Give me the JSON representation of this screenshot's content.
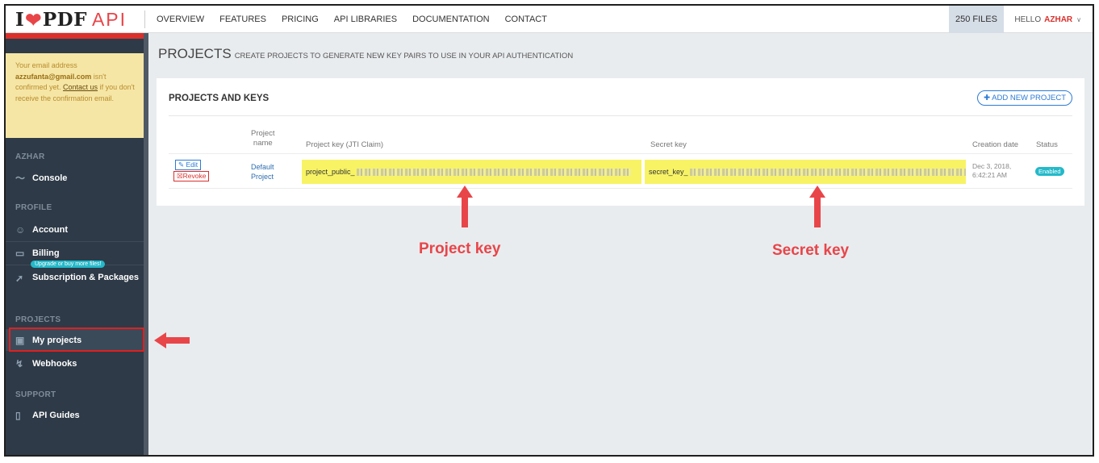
{
  "brand": {
    "i": "I",
    "pdf": "PDF",
    "api": "API"
  },
  "nav": [
    "OVERVIEW",
    "FEATURES",
    "PRICING",
    "API LIBRARIES",
    "DOCUMENTATION",
    "CONTACT"
  ],
  "header": {
    "files": "250 FILES",
    "hello": "HELLO",
    "user": "AZHAR"
  },
  "alert": {
    "pre": "Your email address",
    "email": "azzufanta@gmail.com",
    "mid": " isn't confirmed yet. ",
    "link": "Contact us",
    "post": " if you don't receive the confirmation email."
  },
  "sidebar": {
    "sections": {
      "user": "AZHAR",
      "profile": "PROFILE",
      "projects": "PROJECTS",
      "support": "SUPPORT"
    },
    "items": {
      "console": "Console",
      "account": "Account",
      "billing": "Billing",
      "subscription": "Subscription & Packages",
      "upgrade": "Upgrade or buy more files!",
      "my_projects": "My projects",
      "webhooks": "Webhooks",
      "api_guides": "API Guides"
    }
  },
  "page": {
    "title": "PROJECTS",
    "subtitle": "CREATE PROJECTS TO GENERATE NEW KEY PAIRS TO USE IN YOUR API AUTHENTICATION"
  },
  "card": {
    "heading": "PROJECTS AND KEYS",
    "add_button": "ADD NEW PROJECT",
    "columns": {
      "project_name_1": "Project",
      "project_name_2": "name",
      "project_key": "Project key (JTI Claim)",
      "secret_key": "Secret key",
      "creation_date": "Creation date",
      "status": "Status"
    },
    "row": {
      "edit": "Edit",
      "revoke": "Revoke",
      "name_1": "Default",
      "name_2": "Project",
      "project_key_prefix": "project_public_",
      "secret_key_prefix": "secret_key_",
      "date_1": "Dec 3, 2018,",
      "date_2": "6:42:21 AM",
      "status": "Enabled"
    }
  },
  "annotations": {
    "project_key": "Project key",
    "secret_key": "Secret key"
  },
  "colors": {
    "accent_red": "#e84549",
    "sidebar_bg": "#2e3a47",
    "highlight": "#f7f365",
    "teal": "#23b9c9",
    "link_blue": "#2c7bd6"
  }
}
